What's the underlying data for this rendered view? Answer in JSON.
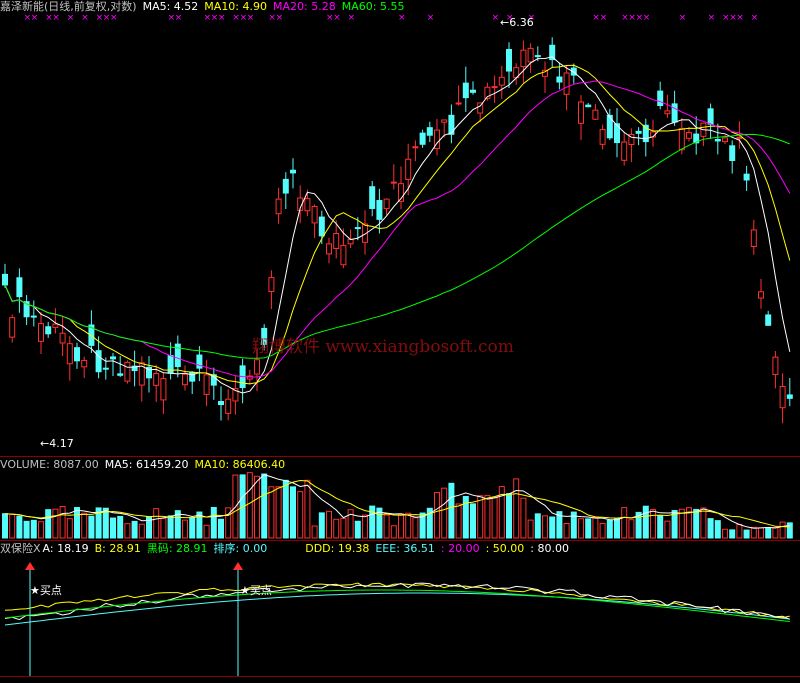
{
  "main": {
    "title": "嘉泽新能(日线,前复权,对数)",
    "ma5": "MA5: 4.52",
    "ma10": "MA10: 4.90",
    "ma20": "MA20: 5.28",
    "ma60": "MA60: 5.55",
    "high_label": "6.36",
    "low_label": "4.17",
    "watermark": "翔博软件 www.xiangbosoft.com",
    "tags": [
      {
        "text": "涨",
        "color": "#ff3030"
      },
      {
        "text": "榜",
        "color": "#ffd700"
      },
      {
        "text": "增",
        "color": "#ff3030"
      },
      {
        "text": "财",
        "color": "#4fc3ff"
      },
      {
        "text": "跌",
        "color": "#30ff30"
      },
      {
        "text": "$",
        "color": "#ff3030"
      }
    ]
  },
  "volume": {
    "label": "VOLUME: 8087.00",
    "ma5": "MA5: 61459.20",
    "ma10": "MA10: 86406.40"
  },
  "indicator": {
    "name": "双保险X",
    "a": "A: 18.19",
    "b": "B: 28.91",
    "heima": "黑码: 28.91",
    "paixu": "排序: 0.00",
    "ddd": "DDD: 19.38",
    "eee": "EEE: 36.51",
    "v20": ": 20.00",
    "v50": ": 50.00",
    "v80": ": 80.00",
    "buy_label": "买点"
  },
  "colors": {
    "up": "#ff3030",
    "down": "#54fcfc",
    "ma5": "#ffffff",
    "ma10": "#ffff00",
    "ma20": "#ff00ff",
    "ma60": "#00ff00",
    "cross": "#ff00ff",
    "grid": "#8b0000"
  }
}
